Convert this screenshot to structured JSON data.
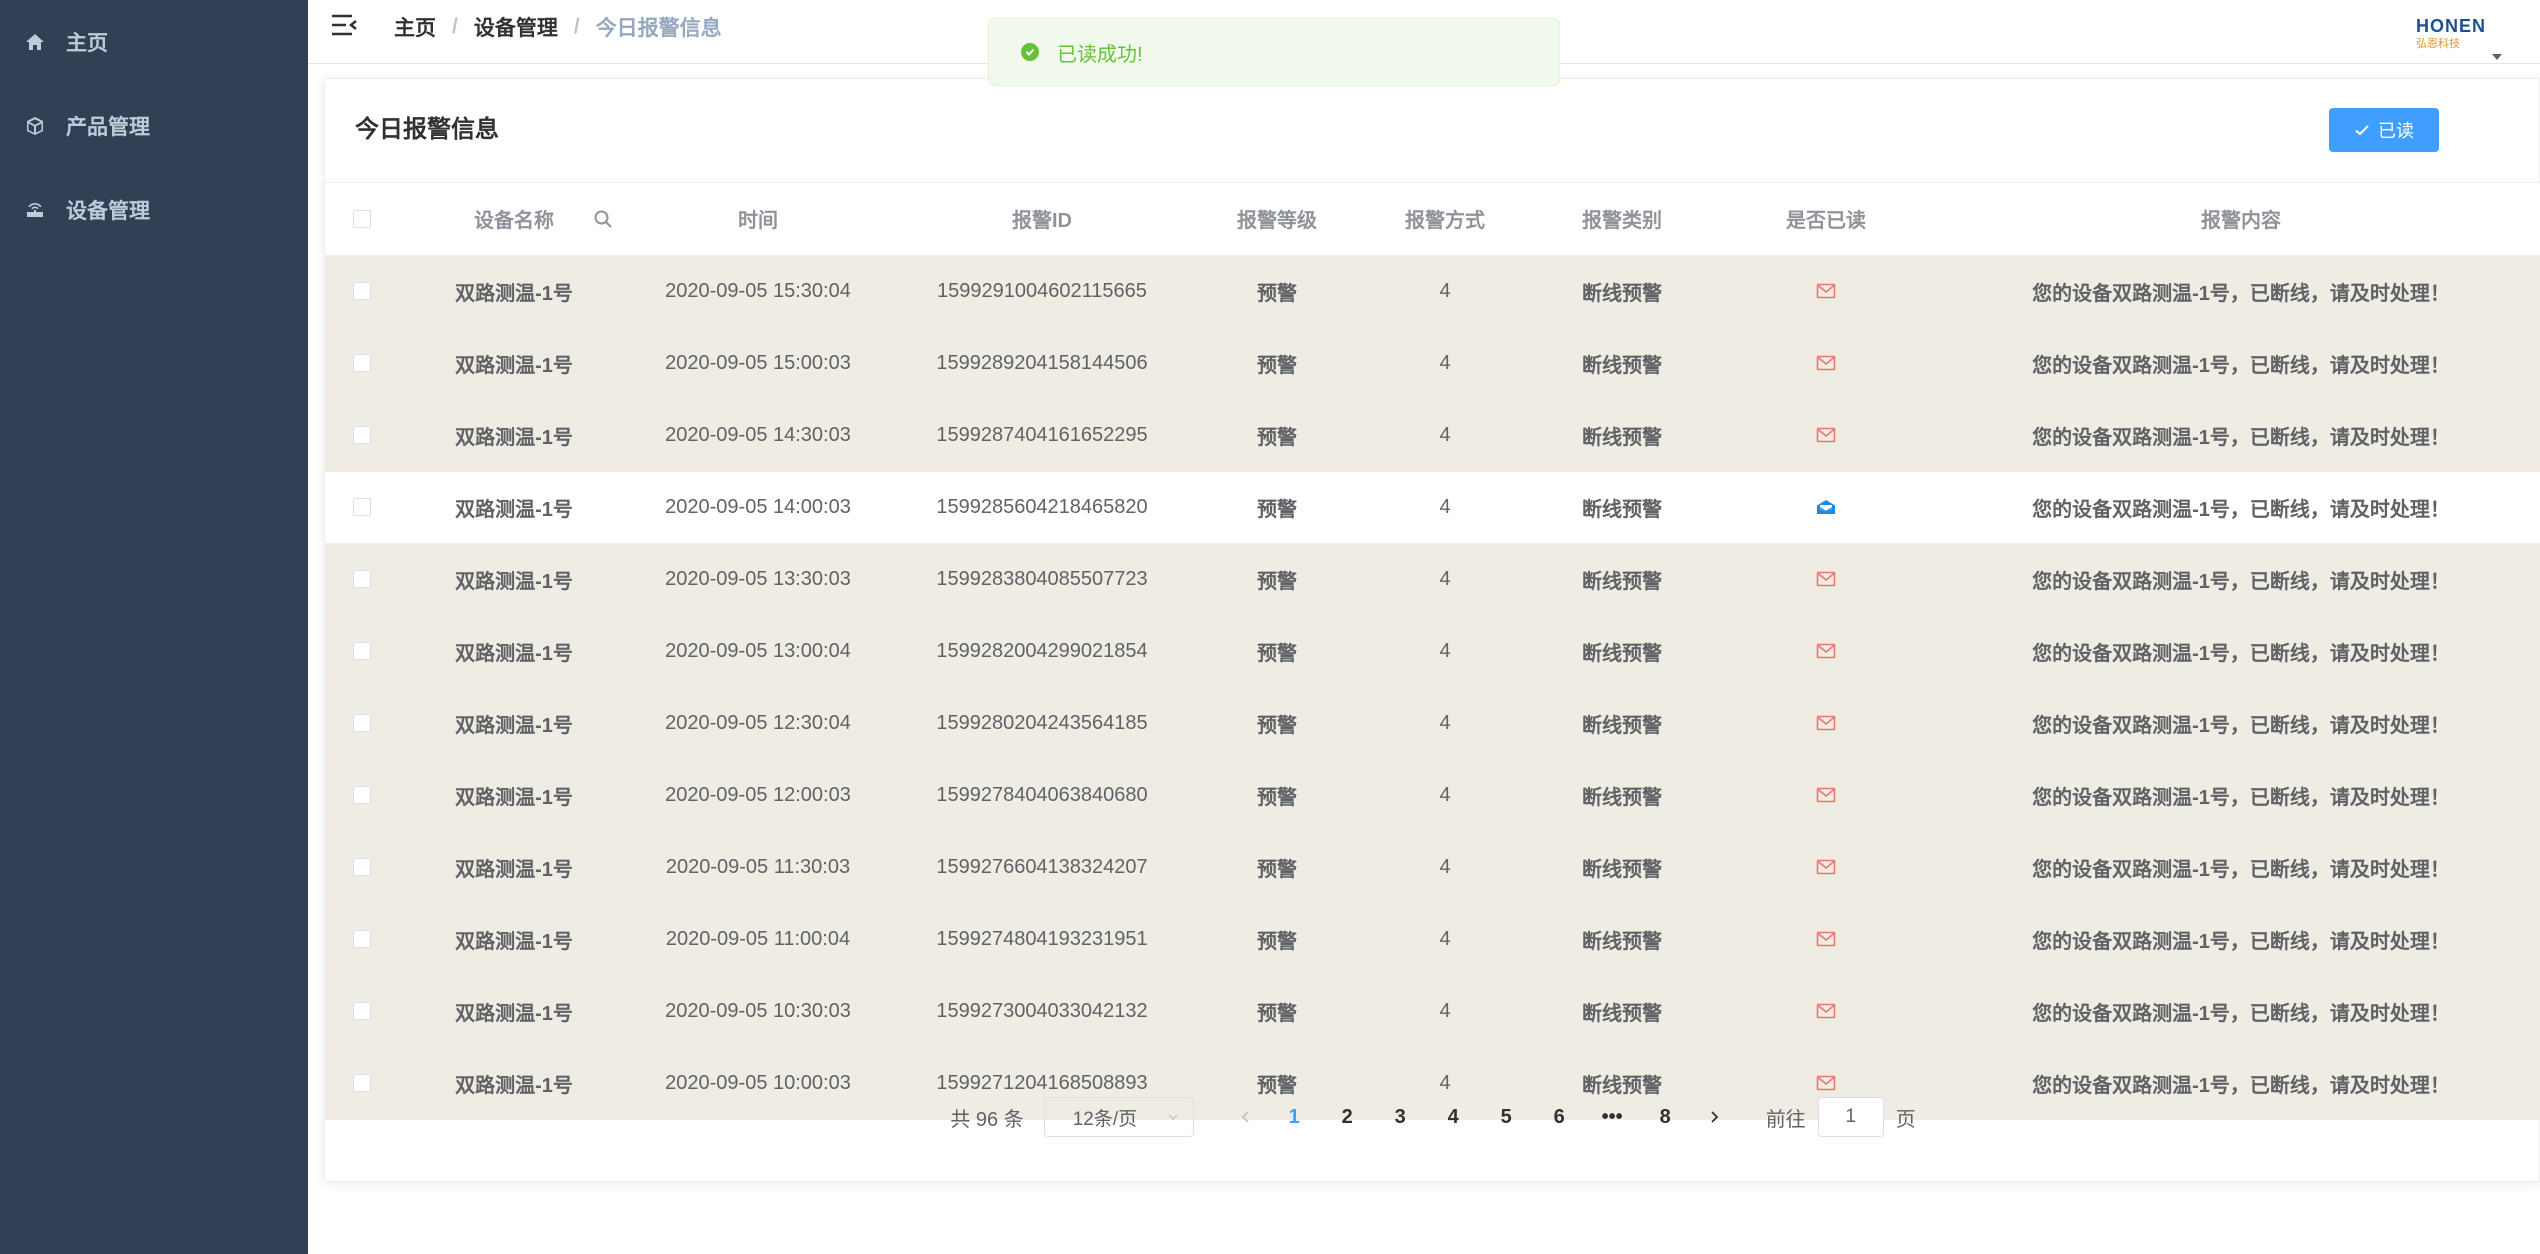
{
  "sidebar": {
    "items": [
      {
        "label": "主页",
        "icon": "home-icon"
      },
      {
        "label": "产品管理",
        "icon": "cube-icon"
      },
      {
        "label": "设备管理",
        "icon": "router-icon"
      }
    ]
  },
  "navbar": {
    "breadcrumb": [
      "主页",
      "设备管理",
      "今日报警信息"
    ],
    "logo_text": "HONEN",
    "logo_sub": "弘恩科技"
  },
  "toast": {
    "message": "已读成功!"
  },
  "card": {
    "title": "今日报警信息",
    "read_button": "已读"
  },
  "table": {
    "columns": [
      "设备名称",
      "时间",
      "报警ID",
      "报警等级",
      "报警方式",
      "报警类别",
      "是否已读",
      "报警内容"
    ],
    "rows": [
      {
        "name": "双路测温-1号",
        "time": "2020-09-05 15:30:04",
        "id": "1599291004602115665",
        "level": "预警",
        "method": "4",
        "category": "断线预警",
        "read": false,
        "content": "您的设备双路测温-1号，已断线，请及时处理！"
      },
      {
        "name": "双路测温-1号",
        "time": "2020-09-05 15:00:03",
        "id": "1599289204158144506",
        "level": "预警",
        "method": "4",
        "category": "断线预警",
        "read": false,
        "content": "您的设备双路测温-1号，已断线，请及时处理！"
      },
      {
        "name": "双路测温-1号",
        "time": "2020-09-05 14:30:03",
        "id": "1599287404161652295",
        "level": "预警",
        "method": "4",
        "category": "断线预警",
        "read": false,
        "content": "您的设备双路测温-1号，已断线，请及时处理！"
      },
      {
        "name": "双路测温-1号",
        "time": "2020-09-05 14:00:03",
        "id": "1599285604218465820",
        "level": "预警",
        "method": "4",
        "category": "断线预警",
        "read": true,
        "content": "您的设备双路测温-1号，已断线，请及时处理！"
      },
      {
        "name": "双路测温-1号",
        "time": "2020-09-05 13:30:03",
        "id": "1599283804085507723",
        "level": "预警",
        "method": "4",
        "category": "断线预警",
        "read": false,
        "content": "您的设备双路测温-1号，已断线，请及时处理！"
      },
      {
        "name": "双路测温-1号",
        "time": "2020-09-05 13:00:04",
        "id": "1599282004299021854",
        "level": "预警",
        "method": "4",
        "category": "断线预警",
        "read": false,
        "content": "您的设备双路测温-1号，已断线，请及时处理！"
      },
      {
        "name": "双路测温-1号",
        "time": "2020-09-05 12:30:04",
        "id": "1599280204243564185",
        "level": "预警",
        "method": "4",
        "category": "断线预警",
        "read": false,
        "content": "您的设备双路测温-1号，已断线，请及时处理！"
      },
      {
        "name": "双路测温-1号",
        "time": "2020-09-05 12:00:03",
        "id": "1599278404063840680",
        "level": "预警",
        "method": "4",
        "category": "断线预警",
        "read": false,
        "content": "您的设备双路测温-1号，已断线，请及时处理！"
      },
      {
        "name": "双路测温-1号",
        "time": "2020-09-05 11:30:03",
        "id": "1599276604138324207",
        "level": "预警",
        "method": "4",
        "category": "断线预警",
        "read": false,
        "content": "您的设备双路测温-1号，已断线，请及时处理！"
      },
      {
        "name": "双路测温-1号",
        "time": "2020-09-05 11:00:04",
        "id": "1599274804193231951",
        "level": "预警",
        "method": "4",
        "category": "断线预警",
        "read": false,
        "content": "您的设备双路测温-1号，已断线，请及时处理！"
      },
      {
        "name": "双路测温-1号",
        "time": "2020-09-05 10:30:03",
        "id": "1599273004033042132",
        "level": "预警",
        "method": "4",
        "category": "断线预警",
        "read": false,
        "content": "您的设备双路测温-1号，已断线，请及时处理！"
      },
      {
        "name": "双路测温-1号",
        "time": "2020-09-05 10:00:03",
        "id": "1599271204168508893",
        "level": "预警",
        "method": "4",
        "category": "断线预警",
        "read": false,
        "content": "您的设备双路测温-1号，已断线，请及时处理！"
      }
    ]
  },
  "pagination": {
    "total_prefix": "共",
    "total": "96",
    "total_suffix": "条",
    "page_size": "12条/页",
    "pages": [
      "1",
      "2",
      "3",
      "4",
      "5",
      "6",
      "•••",
      "8"
    ],
    "current": "1",
    "jump_prefix": "前往",
    "jump_value": "1",
    "jump_suffix": "页"
  },
  "colors": {
    "sidebar_bg": "#304156",
    "accent": "#409eff",
    "unread_row_bg": "#eeece3",
    "unread_icon": "#e8736f",
    "read_icon": "#1e88e5",
    "success": "#67c23a"
  }
}
